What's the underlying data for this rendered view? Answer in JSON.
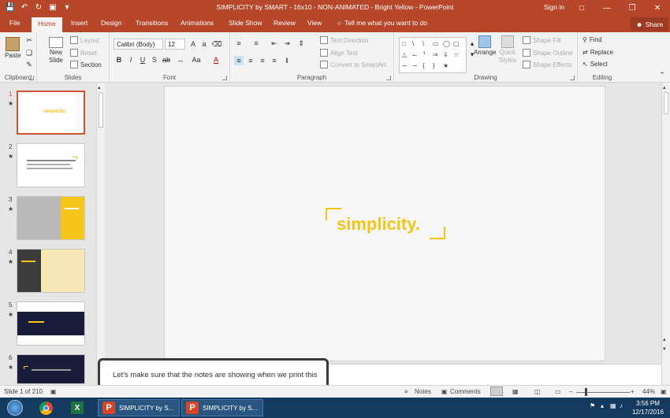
{
  "window": {
    "title": "SIMPLICITY by SMART - 16x10 - NON-ANIMATED - Bright Yellow  -  PowerPoint",
    "signin": "Sign in",
    "share": "Share"
  },
  "qat_icons": [
    "save-icon",
    "undo-icon",
    "redo-icon",
    "start-from-beginning-icon",
    "customize-qat-icon"
  ],
  "tabs": [
    "File",
    "Home",
    "Insert",
    "Design",
    "Transitions",
    "Animations",
    "Slide Show",
    "Review",
    "View"
  ],
  "active_tab": "Home",
  "tell_me": "Tell me what you want to do",
  "ribbon": {
    "clipboard": {
      "label": "Clipboard",
      "paste": "Paste"
    },
    "slides": {
      "label": "Slides",
      "new_slide": "New",
      "new_slide2": "Slide",
      "layout": "Layout",
      "reset": "Reset",
      "section": "Section"
    },
    "font": {
      "label": "Font",
      "name": "Calibri (Body)",
      "size": "12"
    },
    "paragraph": {
      "label": "Paragraph",
      "text_direction": "Text Direction",
      "align_text": "Align Text",
      "convert": "Convert to SmartArt"
    },
    "drawing": {
      "label": "Drawing",
      "arrange": "Arrange",
      "quick_styles": "Quick",
      "quick_styles2": "Styles",
      "shape_fill": "Shape Fill",
      "shape_outline": "Shape Outline",
      "shape_effects": "Shape Effects"
    },
    "editing": {
      "label": "Editing",
      "find": "Find",
      "replace": "Replace",
      "select": "Select"
    }
  },
  "thumbnails": [
    {
      "num": "1",
      "star": "",
      "selected": true
    },
    {
      "num": "2",
      "star": "★",
      "selected": false
    },
    {
      "num": "3",
      "star": "★",
      "selected": false
    },
    {
      "num": "4",
      "star": "★",
      "selected": false
    },
    {
      "num": "5",
      "star": "★",
      "selected": false
    },
    {
      "num": "6",
      "star": "★",
      "selected": false
    }
  ],
  "slide": {
    "logo_text": "simplicity.",
    "accent": "#f5c518"
  },
  "notes": {
    "text": "Let's make sure that the notes are showing when we print this"
  },
  "status": {
    "slide": "Slide 1 of 210",
    "notes": "Notes",
    "comments": "Comments",
    "zoom": "44%"
  },
  "taskbar": {
    "tasks": [
      "SIMPLICITY by S...",
      "SIMPLICITY by S..."
    ],
    "time": "3:56 PM",
    "date": "12/17/2016"
  },
  "colors": {
    "brand": "#b7472a",
    "selection": "#d35230",
    "taskbar": "#153a5f"
  }
}
